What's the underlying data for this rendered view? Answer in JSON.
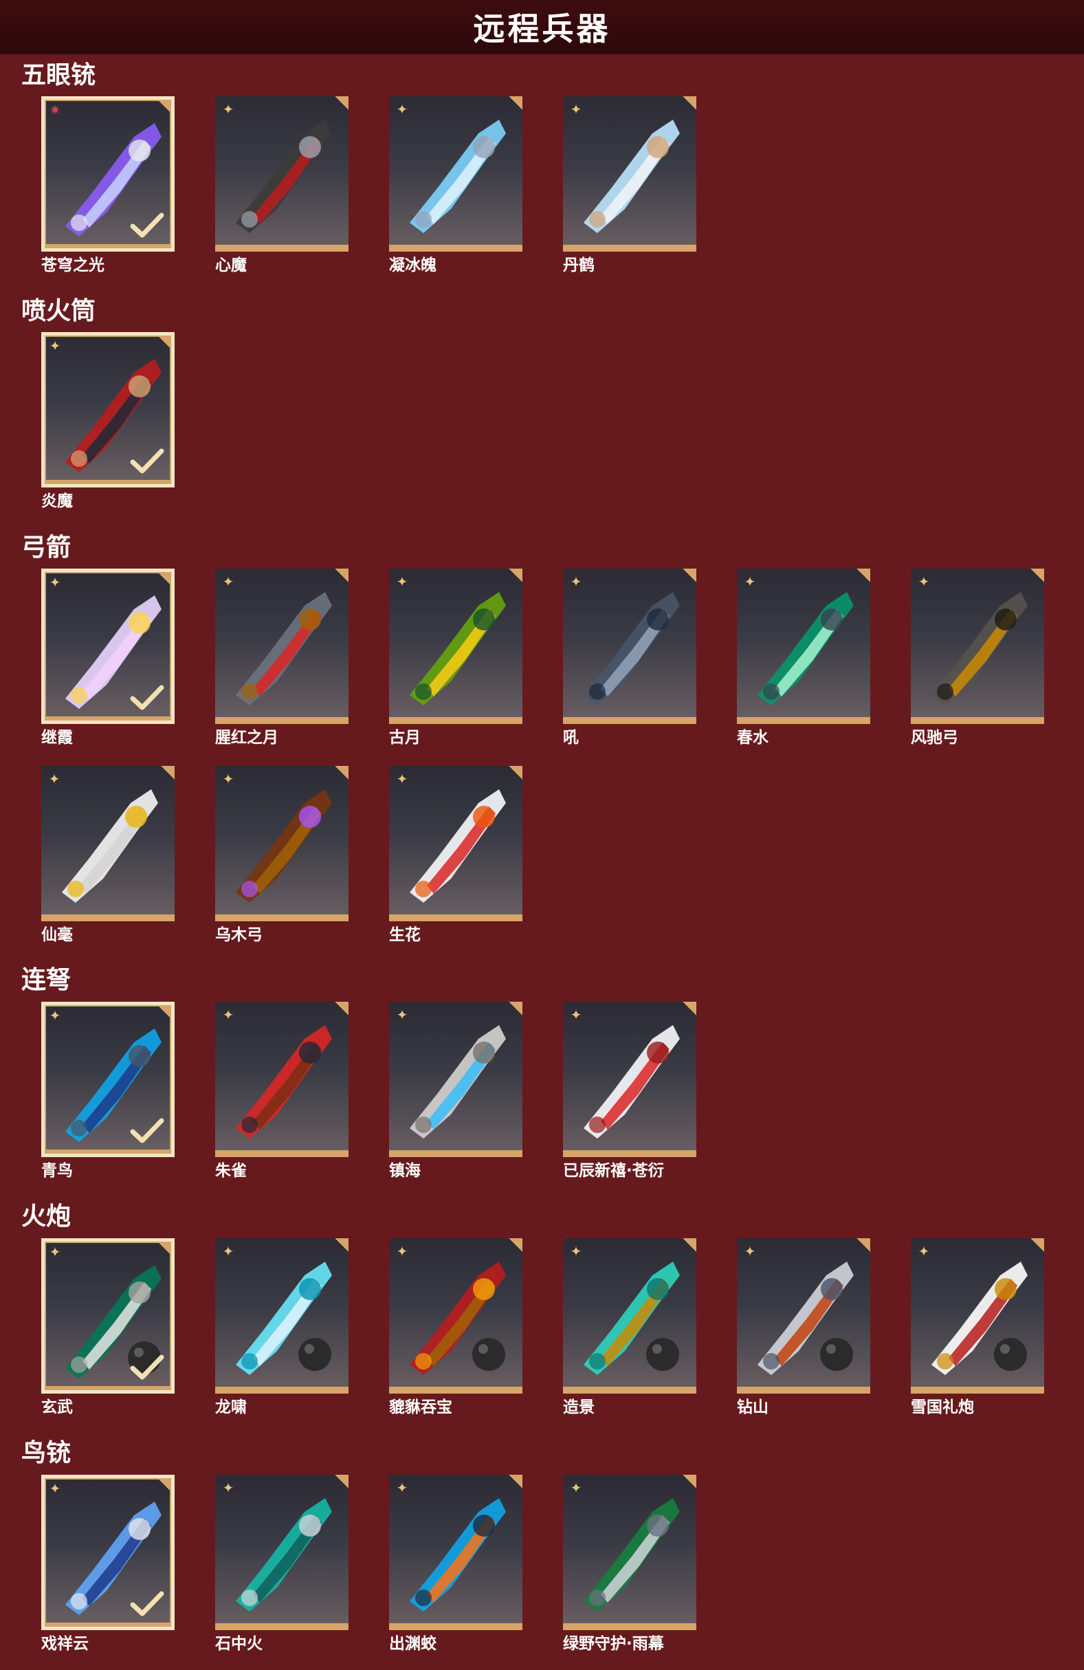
{
  "header": {
    "title": "远程兵器"
  },
  "sections": [
    {
      "title": "五眼铳",
      "items": [
        {
          "name": "苍穹之光",
          "selected": true,
          "rarity": "red-star"
        },
        {
          "name": "心魔",
          "selected": false,
          "rarity": "gold-star"
        },
        {
          "name": "凝冰魄",
          "selected": false,
          "rarity": "gold-star"
        },
        {
          "name": "丹鹤",
          "selected": false,
          "rarity": "gold-star"
        }
      ]
    },
    {
      "title": "喷火筒",
      "items": [
        {
          "name": "炎魔",
          "selected": true,
          "rarity": "gold-star"
        }
      ]
    },
    {
      "title": "弓箭",
      "items": [
        {
          "name": "继霞",
          "selected": true,
          "rarity": "gold-star"
        },
        {
          "name": "腥红之月",
          "selected": false,
          "rarity": "gold-star"
        },
        {
          "name": "古月",
          "selected": false,
          "rarity": "gold-star"
        },
        {
          "name": "吼",
          "selected": false,
          "rarity": "gold-star"
        },
        {
          "name": "春水",
          "selected": false,
          "rarity": "gold-star"
        },
        {
          "name": "风驰弓",
          "selected": false,
          "rarity": "gold-star"
        },
        {
          "name": "仙毫",
          "selected": false,
          "rarity": "gold-star"
        },
        {
          "name": "乌木弓",
          "selected": false,
          "rarity": "gold-star"
        },
        {
          "name": "生花",
          "selected": false,
          "rarity": "gold-star"
        }
      ]
    },
    {
      "title": "连弩",
      "items": [
        {
          "name": "青鸟",
          "selected": true,
          "rarity": "gold-star"
        },
        {
          "name": "朱雀",
          "selected": false,
          "rarity": "gold-star"
        },
        {
          "name": "镇海",
          "selected": false,
          "rarity": "gold-star"
        },
        {
          "name": "已辰新禧·苍衍",
          "selected": false,
          "rarity": "gold-star"
        }
      ]
    },
    {
      "title": "火炮",
      "items": [
        {
          "name": "玄武",
          "selected": true,
          "rarity": "gold-star"
        },
        {
          "name": "龙啸",
          "selected": false,
          "rarity": "gold-star"
        },
        {
          "name": "貔貅吞宝",
          "selected": false,
          "rarity": "gold-star"
        },
        {
          "name": "造景",
          "selected": false,
          "rarity": "gold-star"
        },
        {
          "name": "钻山",
          "selected": false,
          "rarity": "gold-star"
        },
        {
          "name": "雪国礼炮",
          "selected": false,
          "rarity": "gold-star"
        }
      ]
    },
    {
      "title": "鸟铳",
      "items": [
        {
          "name": "戏祥云",
          "selected": true,
          "rarity": "gold-star"
        },
        {
          "name": "石中火",
          "selected": false,
          "rarity": "gold-star"
        },
        {
          "name": "出渊蛟",
          "selected": false,
          "rarity": "gold-star"
        },
        {
          "name": "绿野守护·雨幕",
          "selected": false,
          "rarity": "gold-star"
        }
      ]
    }
  ],
  "colors": {
    "background": "#671a1d",
    "header": "#2c080a",
    "card_bottom_bar": "#d7a46a",
    "selected_border": "#f5e6c4",
    "rarity_gold": "#e9c37e",
    "rarity_red": "#d64053"
  }
}
